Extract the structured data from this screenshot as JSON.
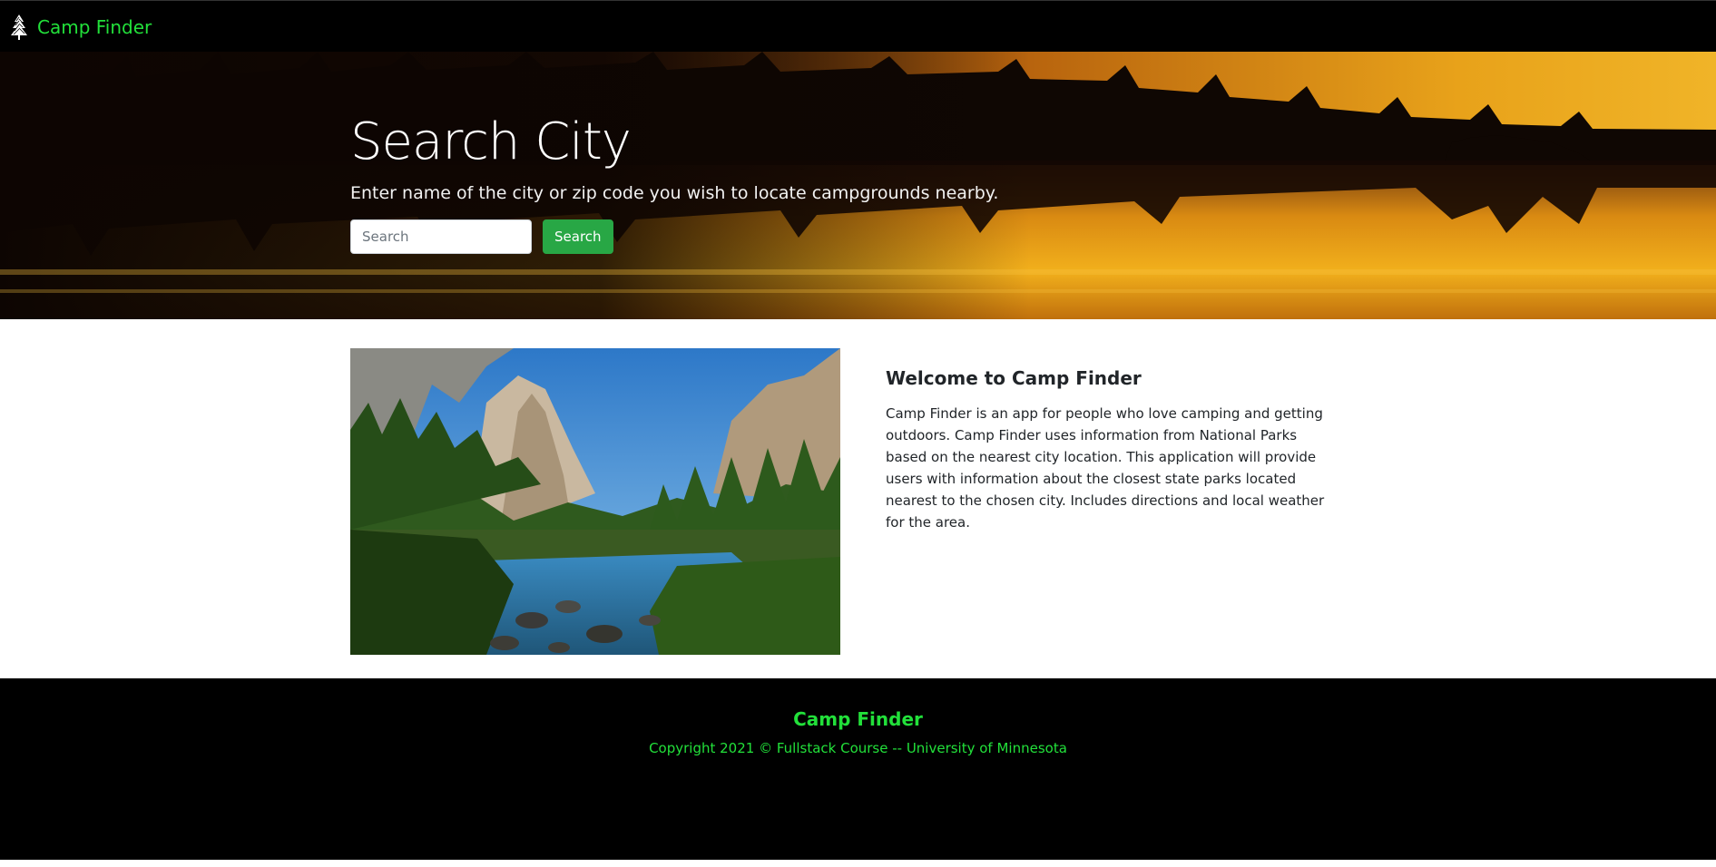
{
  "navbar": {
    "brand_label": "Camp Finder",
    "brand_icon": "tree-icon",
    "brand_color": "#22e03a"
  },
  "hero": {
    "title": "Search City",
    "subtitle": "Enter name of the city or zip code you wish to locate campgrounds nearby.",
    "search_placeholder": "Search",
    "search_value": "",
    "search_button_label": "Search",
    "button_color": "#28a745"
  },
  "welcome": {
    "title": "Welcome to Camp Finder",
    "text": "Camp Finder is an app for people who love camping and getting outdoors. Camp Finder uses information from National Parks based on the nearest city location. This application will provide users with information about the closest state parks located nearest to the chosen city. Includes directions and local weather for the area."
  },
  "footer": {
    "title": "Camp Finder",
    "copyright": "Copyright 2021 © Fullstack Course -- University of Minnesota",
    "text_color": "#22e03a"
  }
}
